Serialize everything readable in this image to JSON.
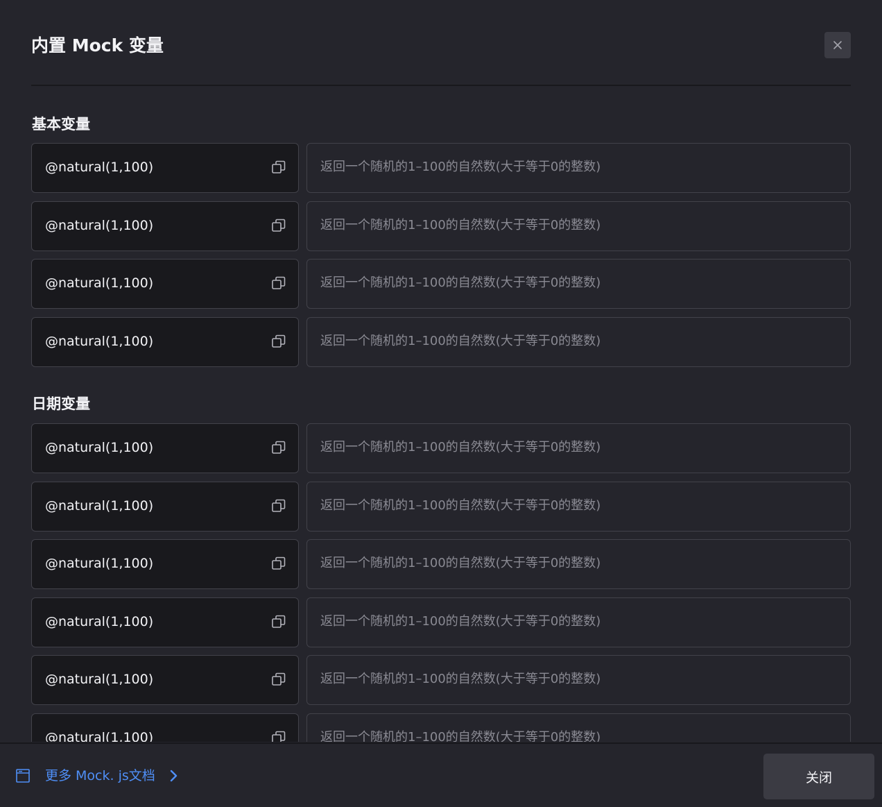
{
  "modal": {
    "title": "内置 Mock 变量"
  },
  "icons": {
    "close": "close-icon",
    "copy": "copy-icon",
    "doc": "browser-window-icon",
    "chevron": "chevron-right-icon"
  },
  "colors": {
    "link": "#4f8ff7"
  },
  "sections": [
    {
      "title": "基本变量",
      "rows": [
        {
          "code": "@natural(1,100)",
          "desc": "返回一个随机的1–100的自然数(大于等于0的整数)"
        },
        {
          "code": "@natural(1,100)",
          "desc": "返回一个随机的1–100的自然数(大于等于0的整数)"
        },
        {
          "code": "@natural(1,100)",
          "desc": "返回一个随机的1–100的自然数(大于等于0的整数)"
        },
        {
          "code": "@natural(1,100)",
          "desc": "返回一个随机的1–100的自然数(大于等于0的整数)"
        }
      ]
    },
    {
      "title": "日期变量",
      "rows": [
        {
          "code": "@natural(1,100)",
          "desc": "返回一个随机的1–100的自然数(大于等于0的整数)"
        },
        {
          "code": "@natural(1,100)",
          "desc": "返回一个随机的1–100的自然数(大于等于0的整数)"
        },
        {
          "code": "@natural(1,100)",
          "desc": "返回一个随机的1–100的自然数(大于等于0的整数)"
        },
        {
          "code": "@natural(1,100)",
          "desc": "返回一个随机的1–100的自然数(大于等于0的整数)"
        },
        {
          "code": "@natural(1,100)",
          "desc": "返回一个随机的1–100的自然数(大于等于0的整数)"
        },
        {
          "code": "@natural(1,100)",
          "desc": "返回一个随机的1–100的自然数(大于等于0的整数)"
        }
      ]
    }
  ],
  "footer": {
    "doc_link": "更多 Mock. js文档",
    "close_label": "关闭"
  }
}
